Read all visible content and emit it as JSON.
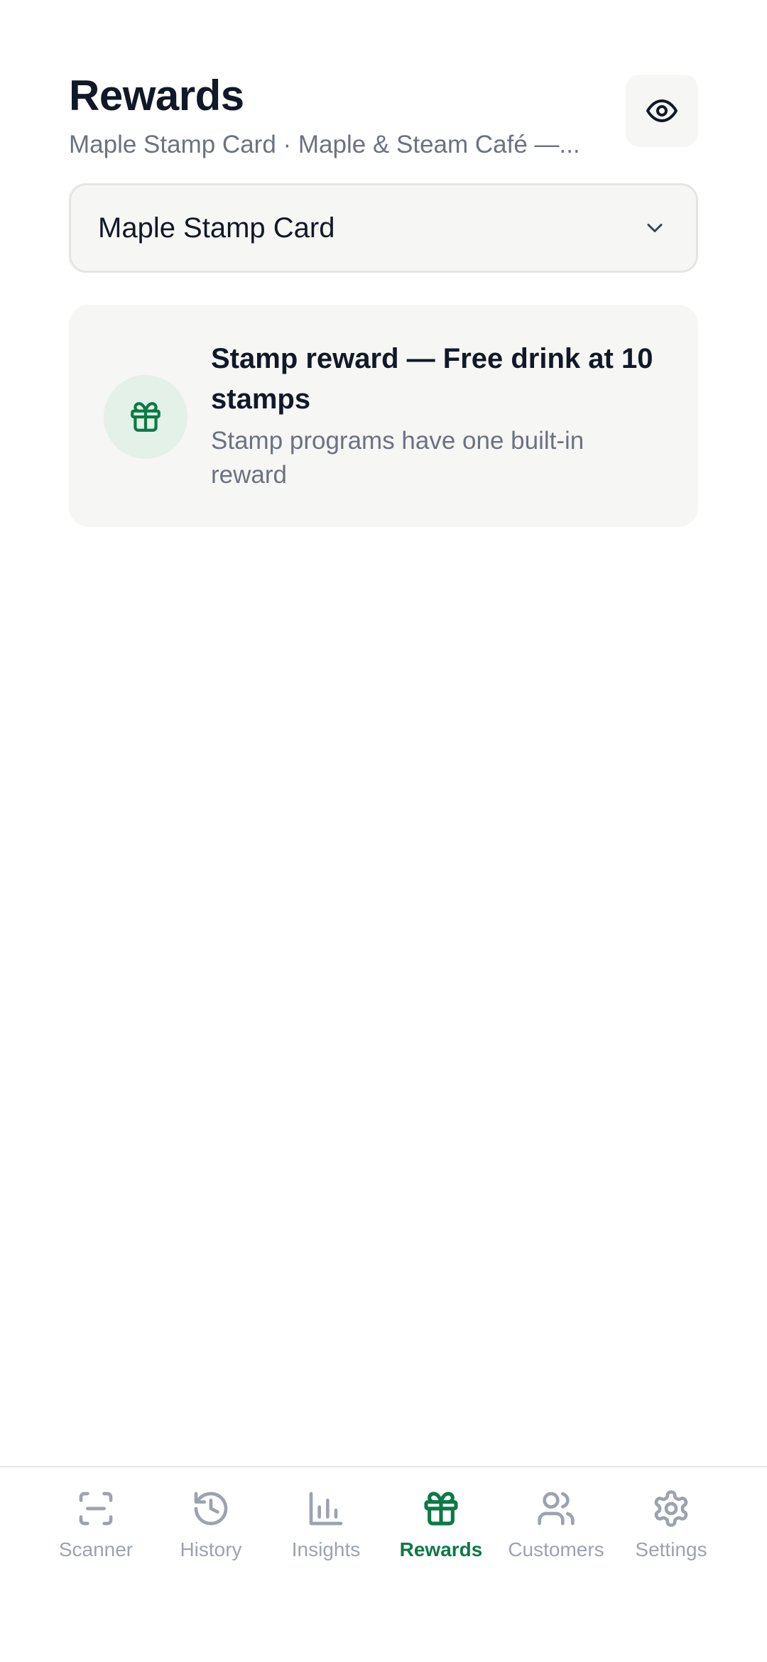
{
  "header": {
    "title": "Rewards",
    "subtitle": "Maple Stamp Card · Maple & Steam Café —...",
    "preview_icon": "eye-icon"
  },
  "program_select": {
    "selected": "Maple Stamp Card",
    "icon": "chevron-down-icon"
  },
  "reward_card": {
    "icon": "gift-icon",
    "title": "Stamp reward — Free drink at 10 stamps",
    "description": "Stamp programs have one built-in reward"
  },
  "nav": {
    "items": [
      {
        "label": "Scanner",
        "icon": "scan-icon",
        "active": false
      },
      {
        "label": "History",
        "icon": "history-icon",
        "active": false
      },
      {
        "label": "Insights",
        "icon": "bar-chart-icon",
        "active": false
      },
      {
        "label": "Rewards",
        "icon": "gift-icon",
        "active": true
      },
      {
        "label": "Customers",
        "icon": "users-icon",
        "active": false
      },
      {
        "label": "Settings",
        "icon": "gear-icon",
        "active": false
      }
    ]
  },
  "colors": {
    "accent": "#0b7a45",
    "muted": "#9ca3af",
    "card_bg": "#f6f6f4",
    "icon_bg": "#e3f1e8"
  }
}
